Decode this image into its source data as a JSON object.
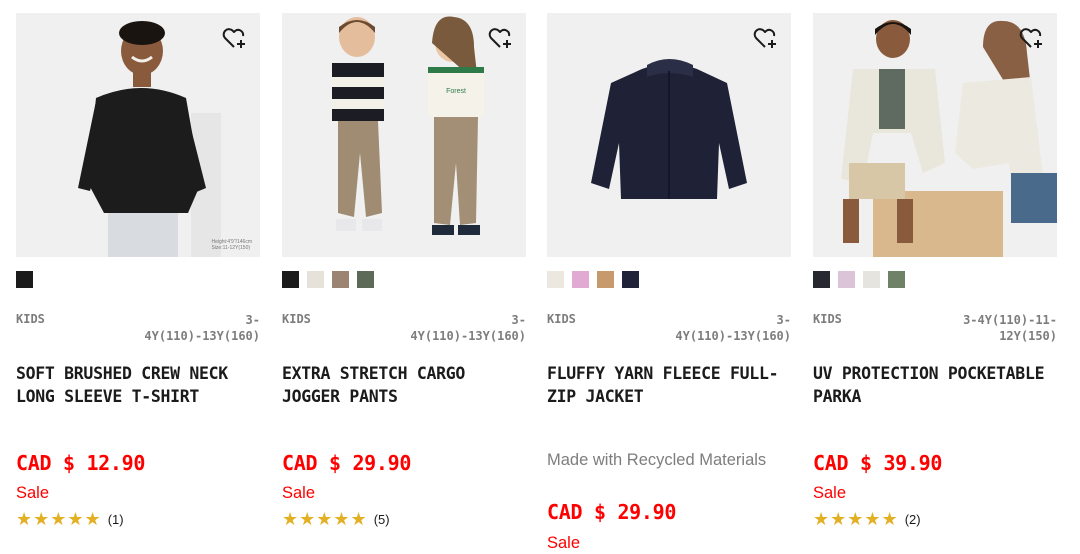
{
  "products": [
    {
      "gender": "KIDS",
      "sizes": "3-\n4Y(110)-13Y(160)",
      "name": "SOFT BRUSHED CREW NECK LONG SLEEVE T-SHIRT",
      "note": "",
      "price": "CAD $ 12.90",
      "sale": "Sale",
      "stars": "★★★★★",
      "reviews": "(1)",
      "image_caption": "Height:4'9\"/146cm\nSize:11-12Y(150)",
      "swatches": [
        "#1b1b1b"
      ]
    },
    {
      "gender": "KIDS",
      "sizes": "3-\n4Y(110)-13Y(160)",
      "name": "EXTRA STRETCH CARGO JOGGER PANTS",
      "note": "",
      "price": "CAD $ 29.90",
      "sale": "Sale",
      "stars": "★★★★★",
      "reviews": "(5)",
      "swatches": [
        "#1b1b1b",
        "#e6e2da",
        "#9c8472",
        "#5d6a58"
      ]
    },
    {
      "gender": "KIDS",
      "sizes": "3-\n4Y(110)-13Y(160)",
      "name": "FLUFFY YARN FLEECE FULL-ZIP JACKET",
      "note": "Made with Recycled Materials",
      "price": "CAD $ 29.90",
      "sale": "Sale",
      "swatches": [
        "#ece8e0",
        "#e2a9d2",
        "#c79a6e",
        "#1f2238"
      ]
    },
    {
      "gender": "KIDS",
      "sizes": "3-4Y(110)-11-\n12Y(150)",
      "name": "UV PROTECTION POCKETABLE PARKA",
      "note": "",
      "price": "CAD $ 39.90",
      "sale": "Sale",
      "stars": "★★★★★",
      "reviews": "(2)",
      "swatches": [
        "#262a30",
        "#dcc4d8",
        "#e6e4de",
        "#6f8166"
      ]
    }
  ]
}
